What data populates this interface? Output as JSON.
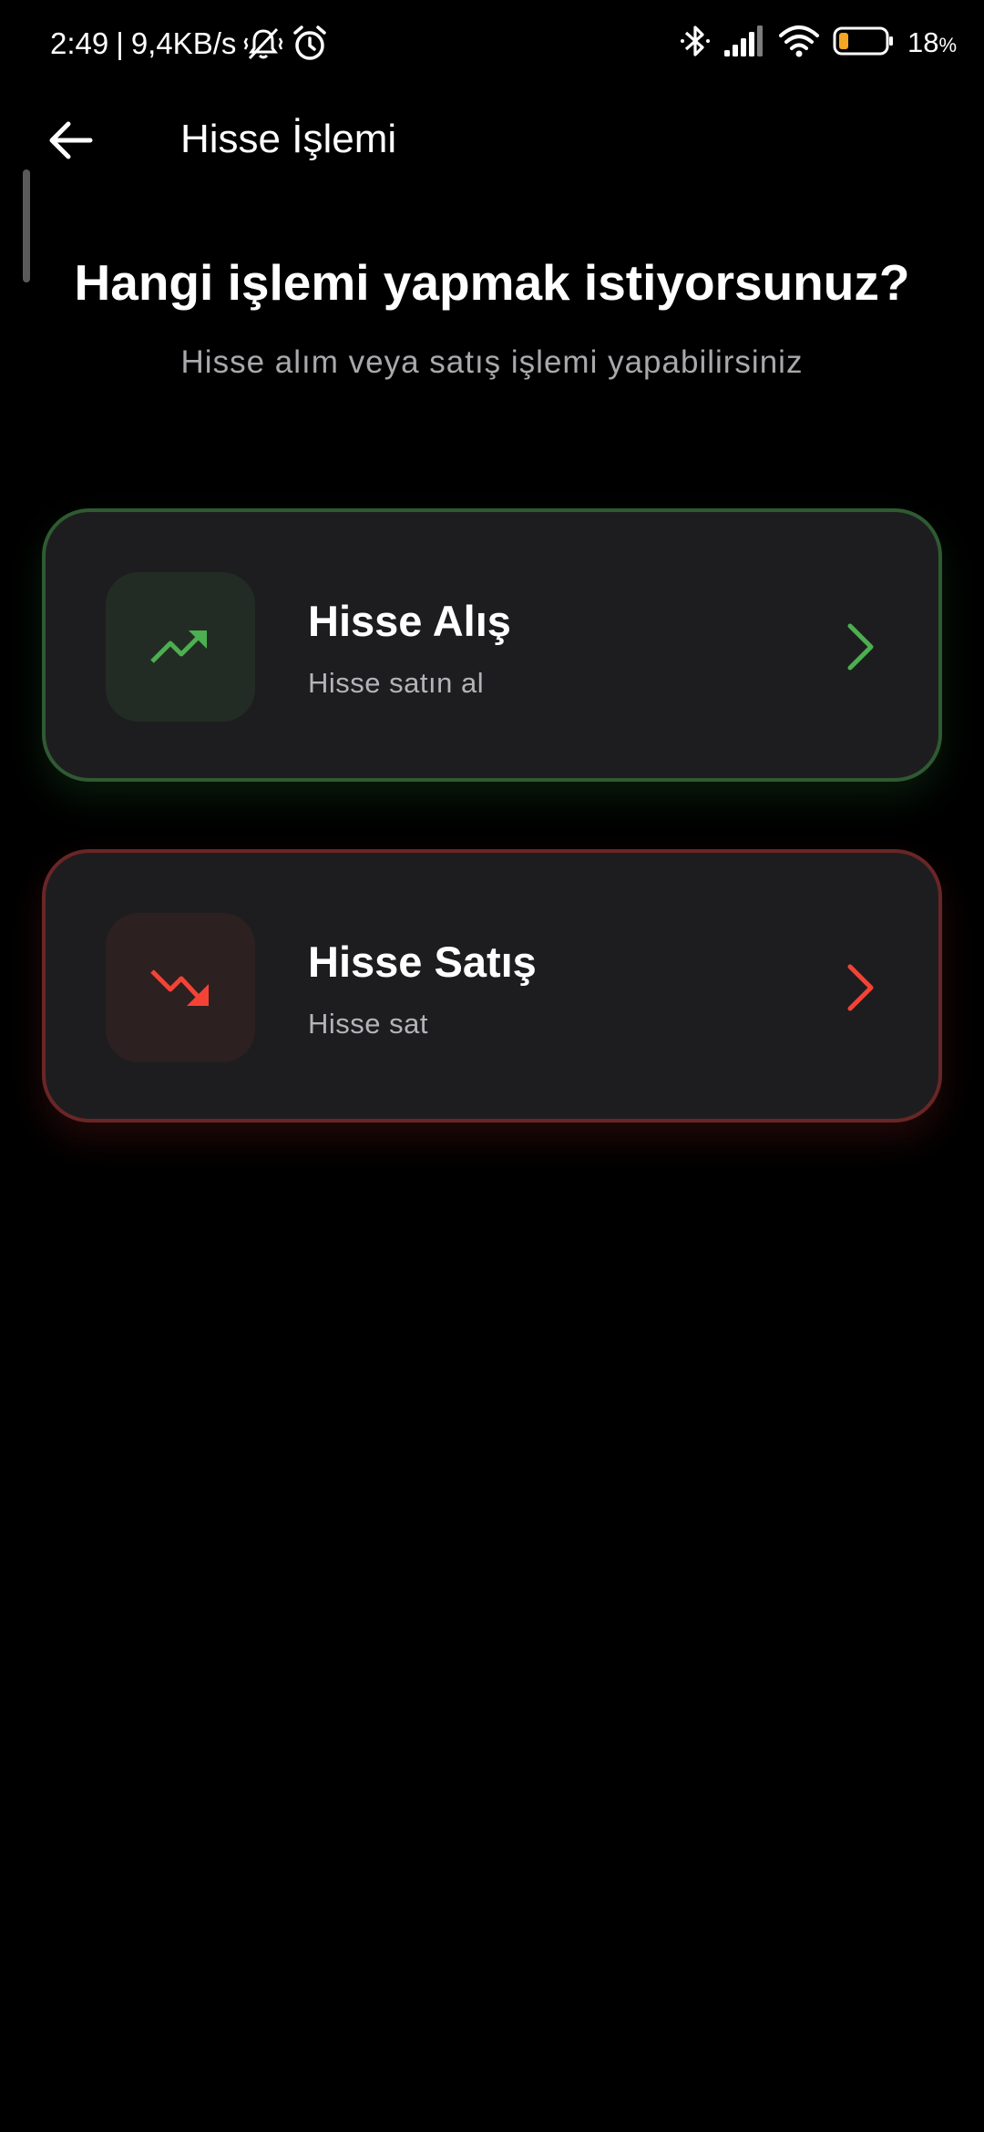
{
  "status_bar": {
    "time": "2:49",
    "separator": "|",
    "network_speed": "9,4KB/s",
    "battery_percent": "18",
    "battery_unit": "%",
    "icons": [
      "vibrate-mute-icon",
      "alarm-icon",
      "bluetooth-icon",
      "signal-icon",
      "wifi-icon",
      "battery-icon"
    ]
  },
  "app_bar": {
    "back_icon": "arrow-left-icon",
    "title": "Hisse İşlemi"
  },
  "main": {
    "heading": "Hangi işlemi yapmak istiyorsunuz?",
    "subheading": "Hisse alım veya satış işlemi yapabilirsiniz"
  },
  "options": {
    "buy": {
      "title": "Hisse Alış",
      "subtitle": "Hisse satın al",
      "icon": "trending-up-icon",
      "accent_color": "#4caf50"
    },
    "sell": {
      "title": "Hisse Satış",
      "subtitle": "Hisse sat",
      "icon": "trending-down-icon",
      "accent_color": "#f44336"
    }
  },
  "colors": {
    "background": "#000000",
    "card_background": "#1d1d1f",
    "buy_border": "#2f5a32",
    "sell_border": "#6a2626",
    "battery_fill": "#f5a623"
  }
}
